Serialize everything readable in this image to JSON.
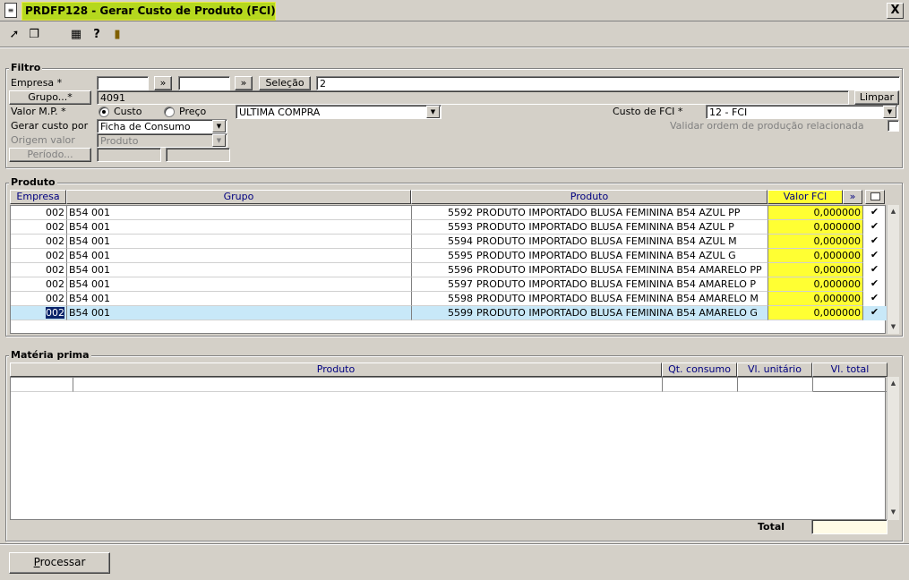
{
  "window": {
    "title": "PRDFP128 - Gerar Custo de Produto (FCI)",
    "close_label": "X"
  },
  "toolbar": {
    "icons": [
      "arrow-icon",
      "copy-icon",
      "grid-icon",
      "help-icon",
      "exit-door-icon"
    ]
  },
  "filtro": {
    "legend": "Filtro",
    "empresa_label": "Empresa *",
    "empresa_from": "",
    "empresa_to": "",
    "expand_label": "»",
    "selecao_label": "Seleção",
    "selecao_value": "2",
    "grupo_label": "Grupo...*",
    "grupo_value": "4091",
    "limpar_label": "Limpar",
    "valor_mp_label": "Valor M.P. *",
    "radio_custo": "Custo",
    "radio_preco": "Preço",
    "valor_mp_selected": "custo",
    "valor_mp_option": "ULTIMA COMPRA",
    "custo_fci_label": "Custo de FCI *",
    "custo_fci_value": "12 - FCI",
    "gerar_custo_label": "Gerar custo por",
    "gerar_custo_value": "Ficha de Consumo",
    "validar_label": "Validar ordem de produção relacionada",
    "origem_label": "Origem valor",
    "origem_value": "Produto",
    "periodo_label": "Período...",
    "periodo_from": "",
    "periodo_to": ""
  },
  "produto": {
    "legend": "Produto",
    "columns": {
      "empresa": "Empresa",
      "grupo": "Grupo",
      "produto": "Produto",
      "valor_fci": "Valor FCI",
      "expand": "»"
    },
    "rows": [
      {
        "empresa": "002",
        "grupo": "B54 001",
        "codigo": "5592",
        "descricao": "PRODUTO IMPORTADO BLUSA FEMININA B54 AZUL PP",
        "valor_fci": "0,000000",
        "checked": "✔"
      },
      {
        "empresa": "002",
        "grupo": "B54 001",
        "codigo": "5593",
        "descricao": "PRODUTO IMPORTADO BLUSA FEMININA B54 AZUL P",
        "valor_fci": "0,000000",
        "checked": "✔"
      },
      {
        "empresa": "002",
        "grupo": "B54 001",
        "codigo": "5594",
        "descricao": "PRODUTO IMPORTADO BLUSA FEMININA B54 AZUL M",
        "valor_fci": "0,000000",
        "checked": "✔"
      },
      {
        "empresa": "002",
        "grupo": "B54 001",
        "codigo": "5595",
        "descricao": "PRODUTO IMPORTADO BLUSA FEMININA B54 AZUL G",
        "valor_fci": "0,000000",
        "checked": "✔"
      },
      {
        "empresa": "002",
        "grupo": "B54 001",
        "codigo": "5596",
        "descricao": "PRODUTO IMPORTADO BLUSA FEMININA B54 AMARELO PP",
        "valor_fci": "0,000000",
        "checked": "✔"
      },
      {
        "empresa": "002",
        "grupo": "B54 001",
        "codigo": "5597",
        "descricao": "PRODUTO IMPORTADO BLUSA FEMININA B54 AMARELO P",
        "valor_fci": "0,000000",
        "checked": "✔"
      },
      {
        "empresa": "002",
        "grupo": "B54 001",
        "codigo": "5598",
        "descricao": "PRODUTO IMPORTADO BLUSA FEMININA B54 AMARELO M",
        "valor_fci": "0,000000",
        "checked": "✔"
      },
      {
        "empresa": "002",
        "grupo": "B54 001",
        "codigo": "5599",
        "descricao": "PRODUTO IMPORTADO BLUSA FEMININA B54 AMARELO G",
        "valor_fci": "0,000000",
        "checked": "✔"
      }
    ],
    "selected_row": 7
  },
  "materia": {
    "legend": "Matéria prima",
    "columns": {
      "produto": "Produto",
      "qt_consumo": "Qt. consumo",
      "vl_unitario": "Vl. unitário",
      "vl_total": "Vl. total"
    },
    "total_label": "Total",
    "total_value": ""
  },
  "footer": {
    "processar_label": "Processar"
  },
  "colors": {
    "highlight_yellow": "#ffff33",
    "title_highlight": "#b5d81e",
    "selected_row": "#c8e8f8",
    "header_text": "#000080"
  }
}
